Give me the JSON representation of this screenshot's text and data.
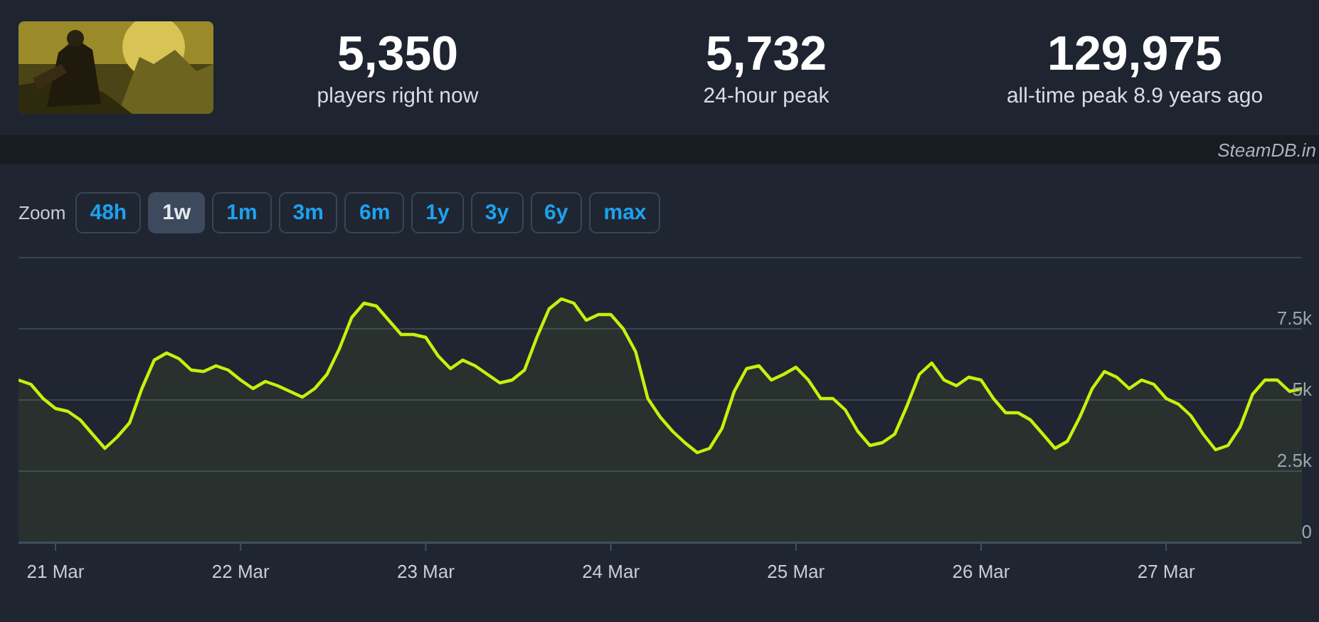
{
  "header": {
    "stats": [
      {
        "value": "5,350",
        "label": "players right now"
      },
      {
        "value": "5,732",
        "label": "24-hour peak"
      },
      {
        "value": "129,975",
        "label": "all-time peak 8.9 years ago"
      }
    ]
  },
  "credit": "SteamDB.in",
  "zoom": {
    "label": "Zoom",
    "options": [
      {
        "label": "48h",
        "selected": false
      },
      {
        "label": "1w",
        "selected": true
      },
      {
        "label": "1m",
        "selected": false
      },
      {
        "label": "3m",
        "selected": false
      },
      {
        "label": "6m",
        "selected": false
      },
      {
        "label": "1y",
        "selected": false
      },
      {
        "label": "3y",
        "selected": false
      },
      {
        "label": "6y",
        "selected": false
      },
      {
        "label": "max",
        "selected": false
      }
    ]
  },
  "chart": {
    "chart_data": {
      "type": "area",
      "grid": true,
      "ylim": [
        0,
        10000
      ],
      "categories": [
        null,
        null,
        null,
        "21 Mar",
        null,
        null,
        null,
        null,
        null,
        null,
        null,
        null,
        null,
        null,
        null,
        null,
        null,
        null,
        "22 Mar",
        null,
        null,
        null,
        null,
        null,
        null,
        null,
        null,
        null,
        null,
        null,
        null,
        null,
        null,
        "23 Mar",
        null,
        null,
        null,
        null,
        null,
        null,
        null,
        null,
        null,
        null,
        null,
        null,
        null,
        null,
        "24 Mar",
        null,
        null,
        null,
        null,
        null,
        null,
        null,
        null,
        null,
        null,
        null,
        null,
        null,
        null,
        "25 Mar",
        null,
        null,
        null,
        null,
        null,
        null,
        null,
        null,
        null,
        null,
        null,
        null,
        null,
        null,
        "26 Mar",
        null,
        null,
        null,
        null,
        null,
        null,
        null,
        null,
        null,
        null,
        null,
        null,
        null,
        null,
        "27 Mar",
        null,
        null,
        null,
        null,
        null,
        null,
        null,
        null,
        null,
        null,
        null
      ],
      "yticks": [
        {
          "value": 0,
          "label": "0"
        },
        {
          "value": 2500,
          "label": "2.5k"
        },
        {
          "value": 5000,
          "label": "5k"
        },
        {
          "value": 7500,
          "label": "7.5k"
        }
      ],
      "series": [
        {
          "color": "#c6f10c",
          "values": [
            5700,
            5550,
            5050,
            4700,
            4600,
            4300,
            3800,
            3300,
            3700,
            4200,
            5400,
            6400,
            6650,
            6450,
            6050,
            6000,
            6200,
            6050,
            5700,
            5400,
            5650,
            5500,
            5300,
            5100,
            5400,
            5900,
            6800,
            7900,
            8400,
            8300,
            7800,
            7300,
            7300,
            7200,
            6550,
            6100,
            6400,
            6200,
            5900,
            5600,
            5700,
            6050,
            7200,
            8200,
            8550,
            8400,
            7800,
            8000,
            8000,
            7500,
            6700,
            5050,
            4400,
            3900,
            3500,
            3150,
            3300,
            4000,
            5300,
            6100,
            6200,
            5700,
            5900,
            6150,
            5700,
            5050,
            5050,
            4650,
            3900,
            3400,
            3500,
            3800,
            4800,
            5900,
            6300,
            5700,
            5500,
            5800,
            5700,
            5050,
            4550,
            4550,
            4300,
            3800,
            3300,
            3550,
            4400,
            5400,
            6000,
            5800,
            5400,
            5700,
            5550,
            5050,
            4850,
            4450,
            3800,
            3250,
            3400,
            4050,
            5200,
            5700,
            5700,
            5300,
            5400
          ]
        }
      ]
    }
  }
}
